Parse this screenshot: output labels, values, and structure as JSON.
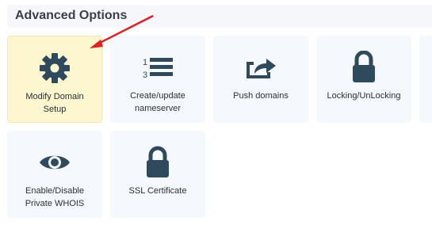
{
  "panel": {
    "title": "Advanced Options"
  },
  "tiles": [
    {
      "label_line1": "Modify Domain",
      "label_line2": "Setup",
      "icon": "gear-icon"
    },
    {
      "label_line1": "Create/update",
      "label_line2": "nameserver",
      "icon": "numbered-list-icon"
    },
    {
      "label": "Push domains",
      "icon": "share-arrow-icon"
    },
    {
      "label": "Locking/UnLocking",
      "icon": "lock-icon"
    },
    {
      "label_line1": "Enable/Disable",
      "label_line2": "Private WHOIS",
      "icon": "eye-icon"
    },
    {
      "label": "SSL Certificate",
      "icon": "lock-icon"
    }
  ],
  "list_icon": {
    "number_1": "1",
    "number_3": "3"
  },
  "colors": {
    "icon": "#2e4a5c",
    "highlight_bg": "#fdf6cf",
    "tile_bg": "#f5f8fc",
    "annotation_arrow": "#e02020"
  }
}
